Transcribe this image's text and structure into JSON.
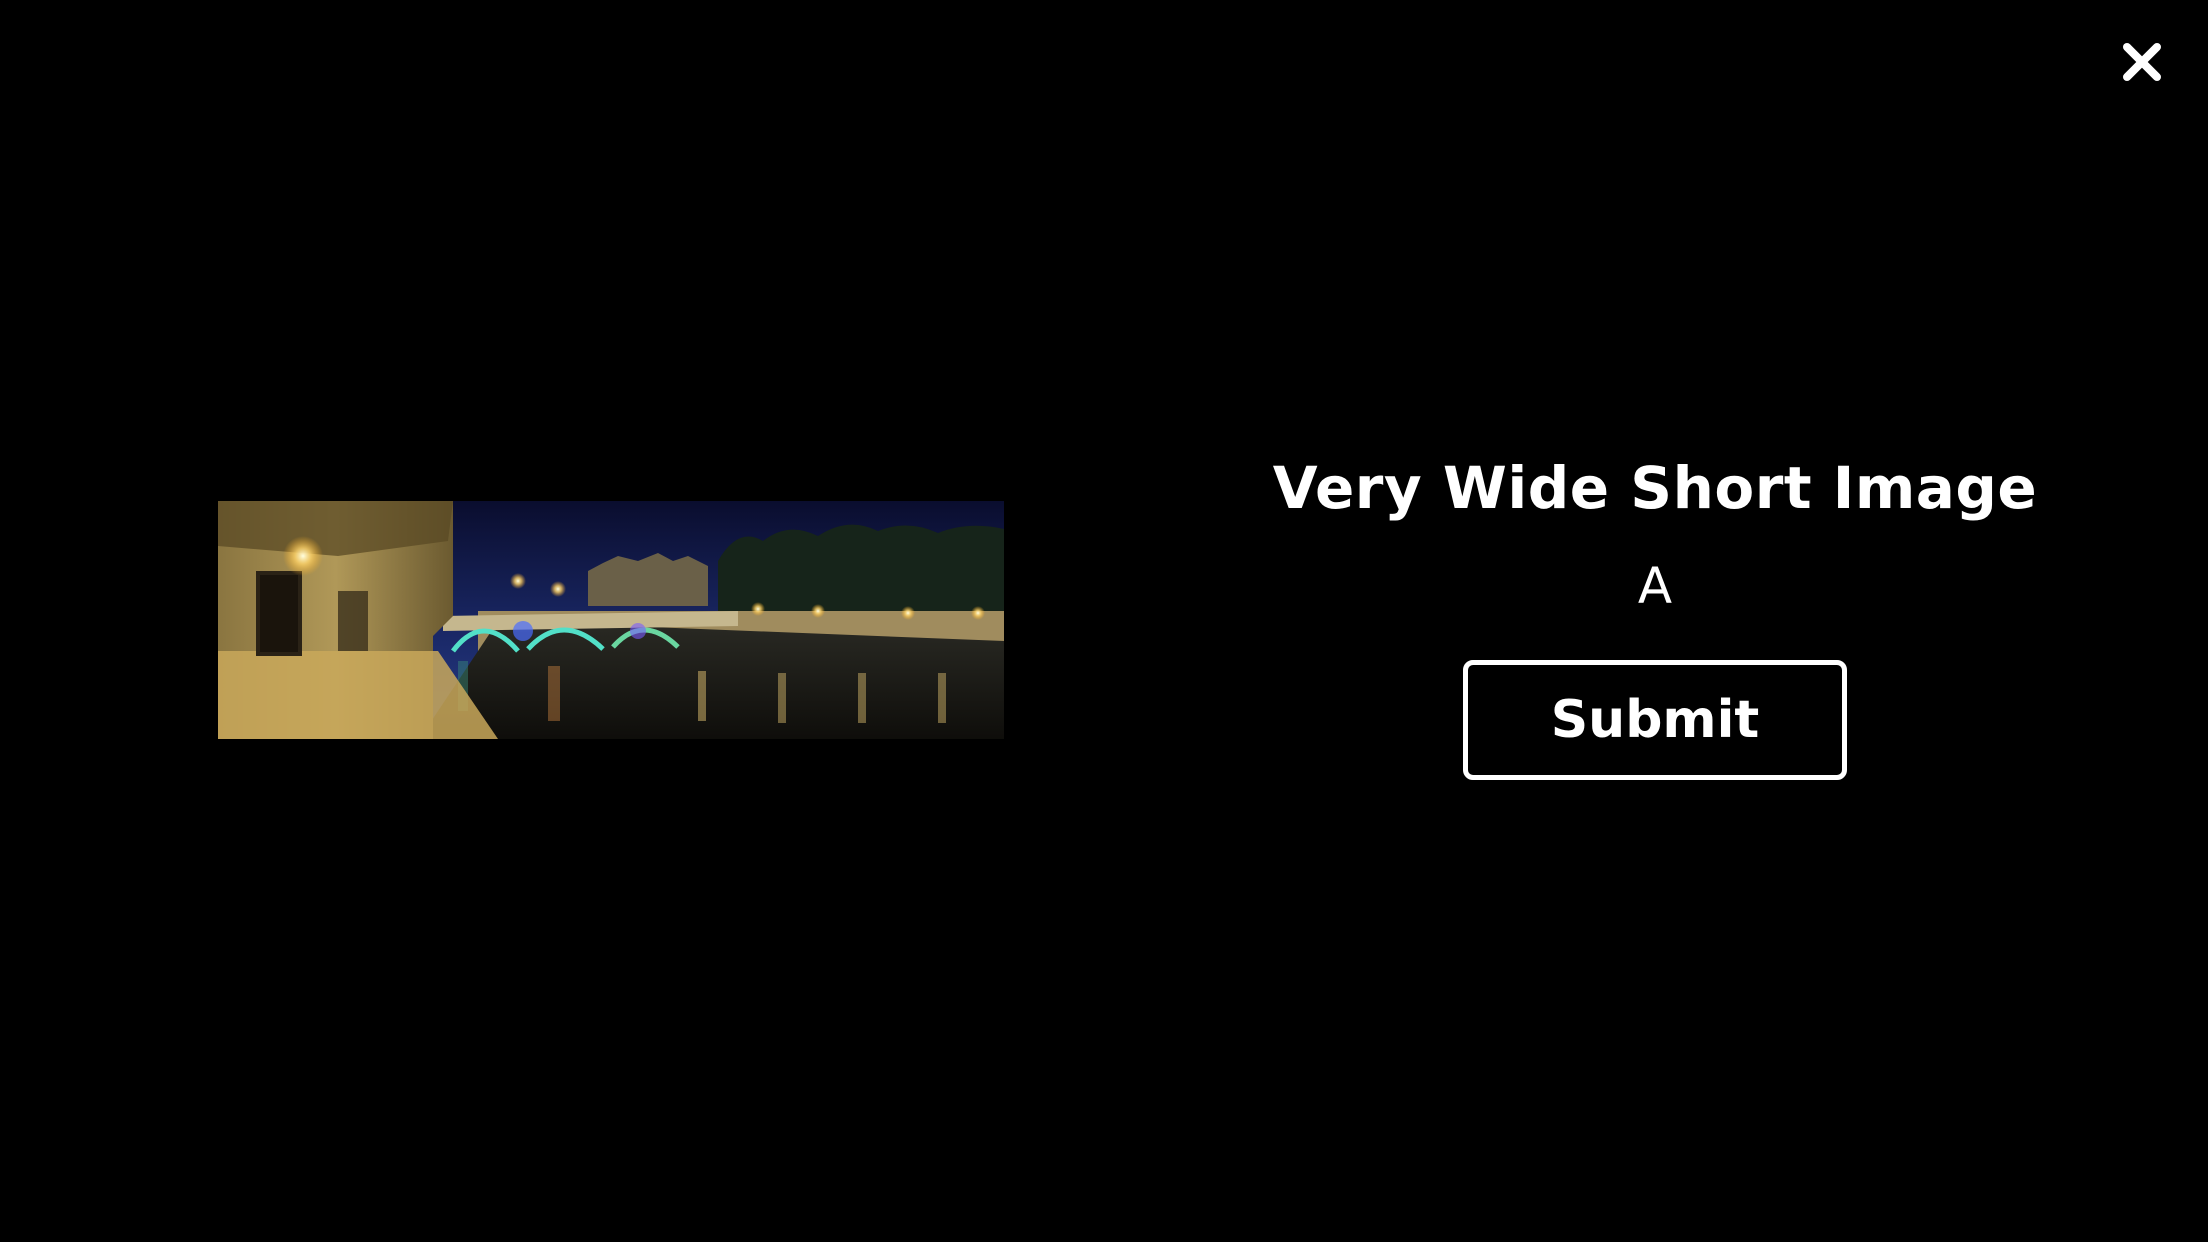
{
  "close": {
    "icon": "close-icon"
  },
  "media": {
    "icon": "night-river-bridge-photo"
  },
  "content": {
    "title": "Very Wide Short Image",
    "subtitle": "A",
    "submit_label": "Submit"
  },
  "colors": {
    "background": "#000000",
    "text": "#ffffff",
    "button_border": "#ffffff"
  }
}
